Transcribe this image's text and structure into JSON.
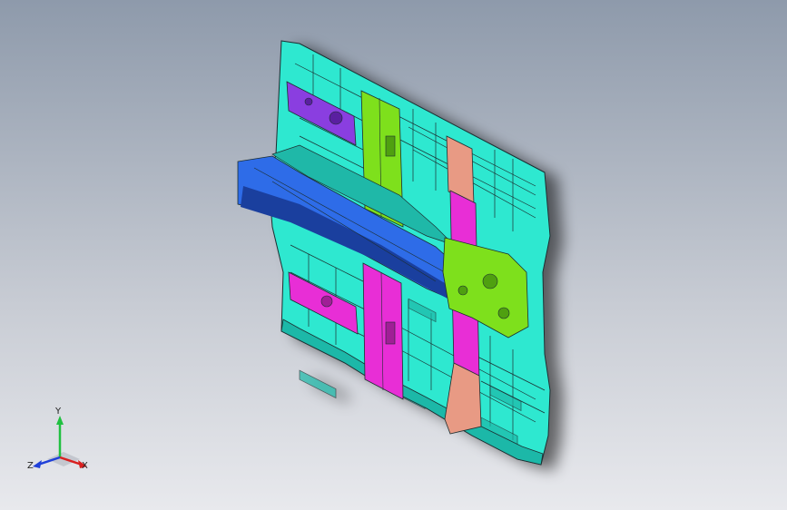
{
  "viewport": {
    "background_top": "#8e9aab",
    "background_bottom": "#e8e9ed"
  },
  "model": {
    "colors": {
      "floor_panel": "#2ee8d0",
      "floor_shade": "#1fb8a8",
      "rail_blue": "#2e6ce8",
      "rail_blue_dark": "#1a3f9e",
      "member_green": "#7ee01c",
      "member_magenta": "#e82ed6",
      "member_salmon": "#e89a84",
      "member_purple": "#8a3ee0",
      "edge": "#1d2e30"
    }
  },
  "triad": {
    "x_label": "X",
    "y_label": "Y",
    "z_label": "Z",
    "x_color": "#d92020",
    "y_color": "#20c040",
    "z_color": "#2040d9"
  }
}
